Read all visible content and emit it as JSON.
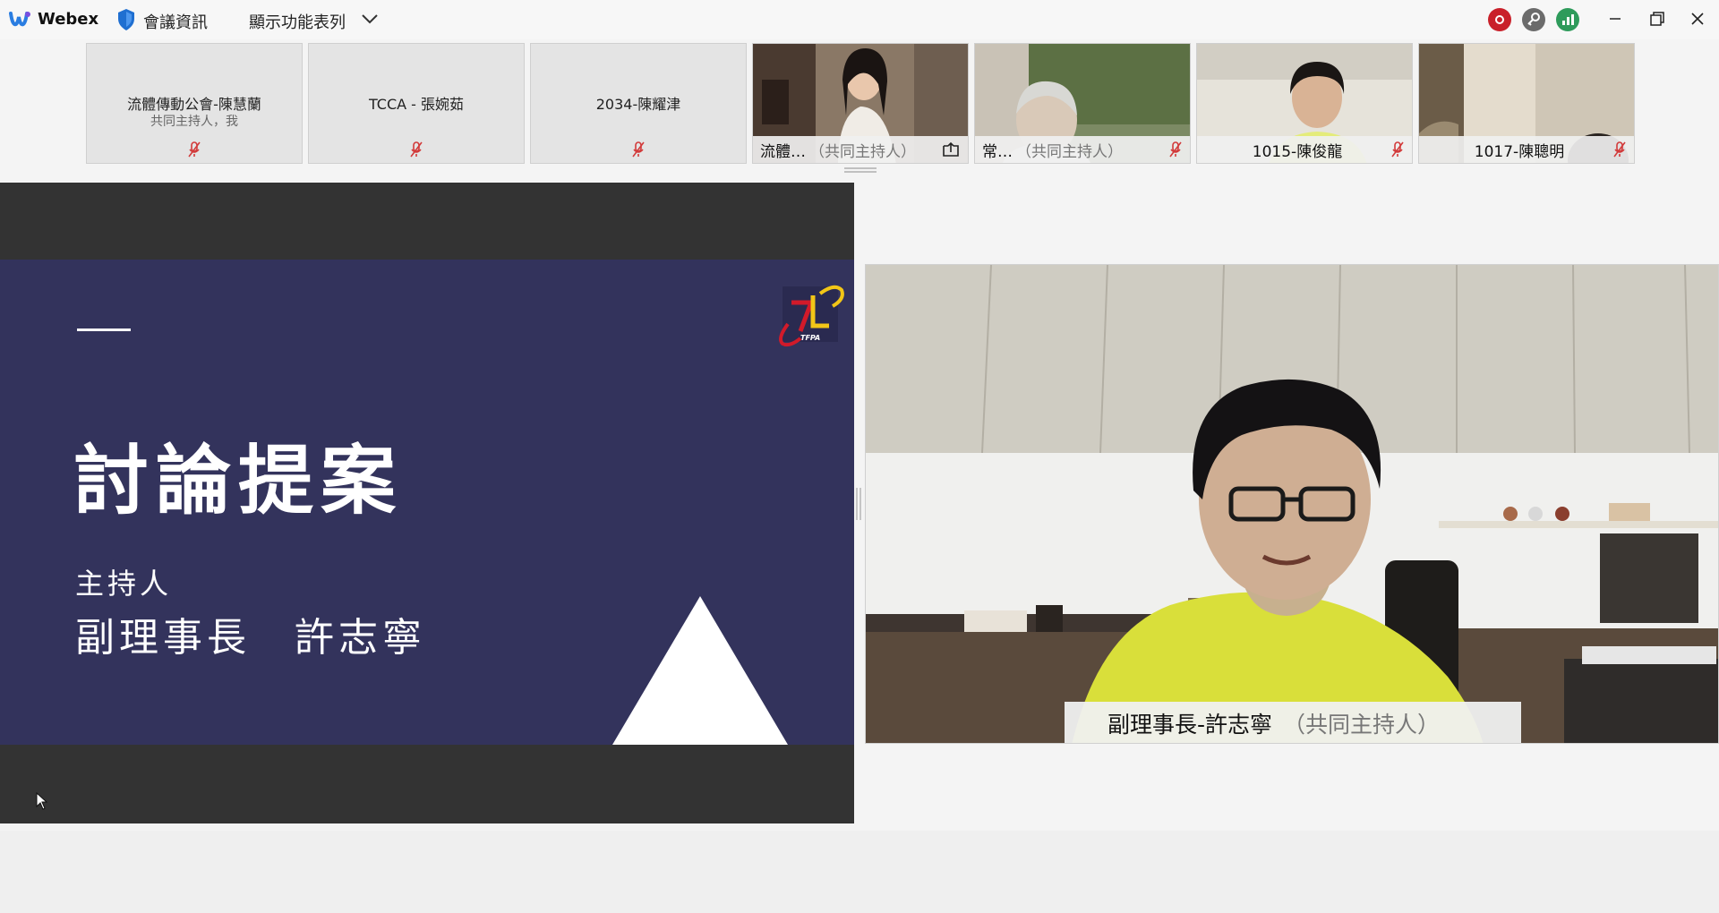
{
  "titlebar": {
    "app_name": "Webex",
    "meeting_info": "會議資訊",
    "menu_toggle": "顯示功能表列"
  },
  "participants": [
    {
      "name": "流體傳動公會-陳慧蘭",
      "subtitle": "共同主持人，我",
      "muted": true,
      "video": false
    },
    {
      "name": "TCCA - 張婉茹",
      "muted": true,
      "video": false
    },
    {
      "name": "2034-陳耀津",
      "muted": true,
      "video": false
    },
    {
      "name": "流體…",
      "role": "（共同主持人）",
      "sharing": true,
      "video": true
    },
    {
      "name": "常…",
      "role": "（共同主持人）",
      "muted": true,
      "video": true
    },
    {
      "name": "1015-陳俊龍",
      "muted": true,
      "video": true
    },
    {
      "name": "1017-陳聰明",
      "muted": true,
      "video": true
    }
  ],
  "slide": {
    "title": "討論提案",
    "host_label": "主持人",
    "host_name": "副理事長　許志寧",
    "logo_text": "TFPA"
  },
  "speaker": {
    "name": "副理事長-許志寧",
    "role": "（共同主持人）"
  },
  "colors": {
    "recording": "#c9202a",
    "stats": "#2e9b5b",
    "slide_bg": "#33335c",
    "mute_red": "#d23a3a"
  }
}
